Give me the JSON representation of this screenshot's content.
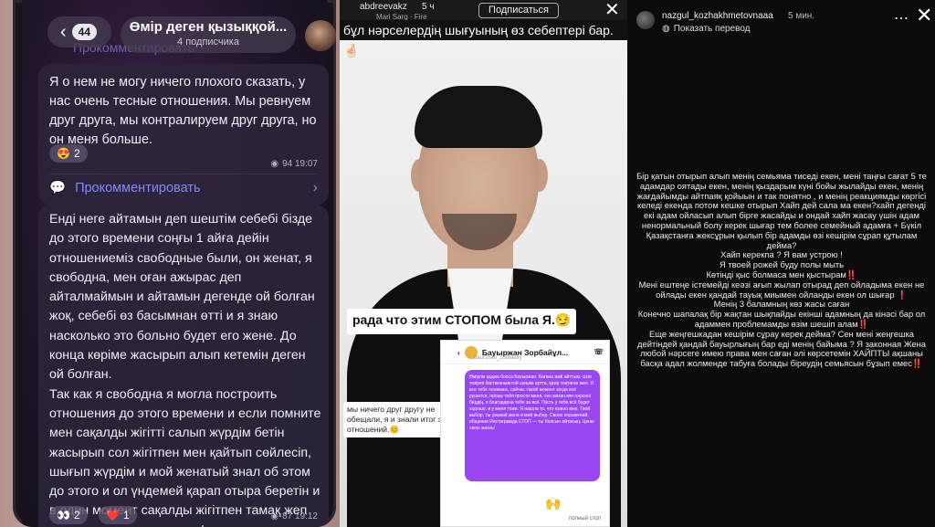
{
  "panel1": {
    "back_count": "44",
    "channel_title": "Өмір деген қызыққой...",
    "subscribers": "4 подписчика",
    "prev_comment": "Прокомментировать",
    "post1": {
      "text": "Я о нем не могу ничего плохого сказать, у нас очень тесные отношения. Мы ревнуем друг друга, мы контралируем друг друга, но он меня больше.",
      "reaction_emoji": "😍",
      "reaction_count": "2",
      "views_time": "94 19:07",
      "comment_label": "Прокомментировать"
    },
    "post2": {
      "text": "Енді неге айтамын деп шештім себебі бізде до этого времени соңғы 1 айға дейін отношениеміз свободные были, он женат, я свободна, мен оған ажырас деп айталмаймын и айтамын дегенде ой болған жоқ, себебі өз басымнан өтті и я знаю насколько это больно будет его жене. До конца көріме жасырып алып кетемін деген ой болған.\nТак как я свободна я могла построить отношения до этого времени и если помните мен сақалды жігітті салып жүрдім бетін жасырып сол жігітпен мен қайтып сөйлесіп, шығып жүрдім и мой женатый знал об этом до этого и ол үндемей қарап отыра беретін и в один момент сақалды жігітпен тамақ жеп отырмыз и звонтк в телефон...",
      "reaction1_emoji": "👀",
      "reaction1_count": "2",
      "reaction2_emoji": "❤️",
      "reaction2_count": "1",
      "views_time": "87 19:12"
    }
  },
  "panel2": {
    "username": "abdreevakz",
    "time": "5 ч",
    "music": "Mari Sarg · Fire",
    "follow_label": "Подписаться",
    "caption_top": "бұл нәрселердің шығуының өз себептері бар.🤞🏻",
    "caption_mid": "рада что этим СТОПОМ была Я.😏",
    "caption_low": "мы ничего друг другу не обещали, я и знали итог этих отношений.😊",
    "inset_name": "Бауыржан Зорбайұл...",
    "inset_handle": "baurzhan_zorbaiuly",
    "inset_message": "Өмірлік қадам болса Бауыржан. Бағана жай айттым, сізге тезірек бастағаным ғой шешім артта, қазір тоқтаған жөн. Я все тебе понимаю, сейчас такой момент когда всё рушится, прошу тебя прости меня, сен маған көп нәрсені бердің, я благодарна тебе за всё. Пусть у тебя всё будет хорошо, и у меня тоже. Я нашла то, что нужно мне. Твой выбор, ты уважай меня и мой выбор. Своих поражений, общения Инстаграмда СТОП — ты болсын айтасың. Ценю свою жизнь!",
    "inset_reply": "полный стоп"
  },
  "panel3": {
    "username": "nazgul_kozhakhmetovnaaa",
    "time": "5 мин.",
    "translate": "Показать перевод",
    "story_text_parts": [
      {
        "t": "Бір қатын отырып алып менің семьяма тиседі екен, мені таңғы сағат 5 те адамдар оятады екен, менің қыздарым күні бойы жылайды екен, менің жағдайымды айтпаяқ қойыын и так понятно , и менің реакциямды көргісі келеді екенда  потом кешке отырып Хайп дей сала ма екен?хайп дегенді екі адам ойласып алып бірге жасайды и ондай хайп жасау үшін адам ненормальный болу керек шығар тем более семейный адамға + Бүкіл Қазақстанға  жексұрын қылып бір адамды өзі кешірім сұрап құтылам дейма?\nХайп керекпа ? Я вам устрою !\nЯ твоей рожей буду полы мыть\nКөтінді қыс болмаса мен қыстырам",
        "red": false
      },
      {
        "t": "‼️",
        "red": true
      },
      {
        "t": "\nМені ештеңе істемейді кеәзі ағып жылап отырад деп ойладыма екен не ойлады екен қандай тауық миымен ойланды екен ол шығар ",
        "red": false
      },
      {
        "t": "❗",
        "red": true
      },
      {
        "t": "\nМенің 3 баламның көз жасы саған\nКонечно шапалақ бір жақтан шықпайды екінші адамның да кінәсі бар ол адаммен проблемамды өзім шешіп алам",
        "red": false
      },
      {
        "t": "‼️",
        "red": true
      },
      {
        "t": "\nЕще жеңгешкадан кешірім сұрау керек деймa? Сен мені жеңгешка дейтіндей қандай бауырлығың бар еді  менің байыма ? Я законная Жена любой нәрсеге имею права мен саған әлі көрсетемін ХАЙПТЫ ақшаны басқа адал жолменде табуға болады біреудің семьясын бұзып емес",
        "red": false
      },
      {
        "t": "‼️",
        "red": true
      }
    ]
  }
}
